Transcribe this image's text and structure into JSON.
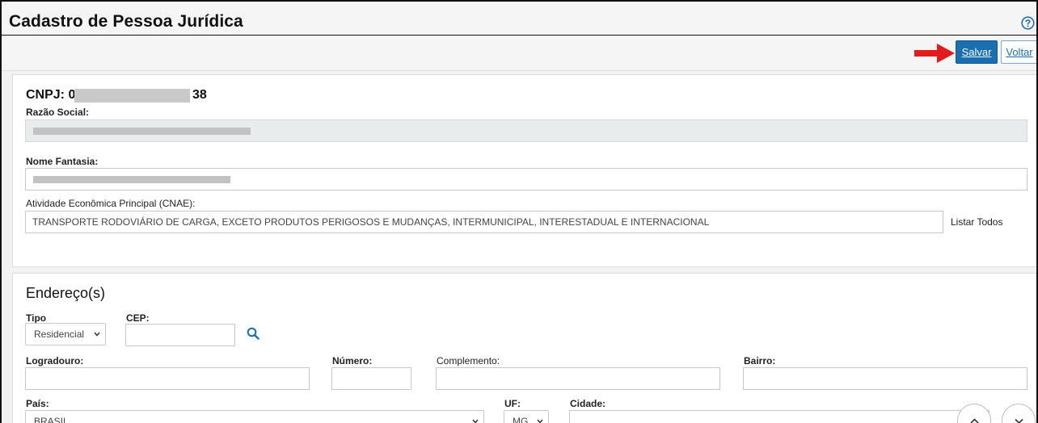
{
  "page": {
    "title": "Cadastro de Pessoa Jurídica",
    "help_icon": "help-circle-icon"
  },
  "toolbar": {
    "save_label": "Salvar",
    "back_label": "Voltar",
    "arrow_icon": "red-arrow-right-icon",
    "accent": "#1a6fb0",
    "arrow_color": "#e21b1b"
  },
  "company": {
    "cnpj_prefix": "CNPJ: 0",
    "cnpj_suffix": "38",
    "razao_social_label": "Razão Social:",
    "nome_fantasia_label": "Nome Fantasia:",
    "cnae_label": "Atividade Econômica Principal (CNAE):",
    "cnae_value": "TRANSPORTE RODOVIÁRIO DE CARGA, EXCETO PRODUTOS PERIGOSOS E MUDANÇAS, INTERMUNICIPAL, INTERESTADUAL E INTERNACIONAL",
    "list_all_label": "Listar Todos"
  },
  "address": {
    "section_title": "Endereço(s)",
    "tipo_label": "Tipo",
    "tipo_value": "Residencial",
    "cep_label": "CEP:",
    "search_icon": "search-icon",
    "logradouro_label": "Logradouro:",
    "numero_label": "Número:",
    "complemento_label": "Complemento:",
    "bairro_label": "Bairro:",
    "pais_label": "País:",
    "pais_value": "BRASIL",
    "uf_label": "UF:",
    "uf_value": "MG",
    "cidade_label": "Cidade:"
  },
  "scroll": {
    "up_icon": "chevron-up-icon",
    "down_icon": "chevron-down-icon"
  }
}
